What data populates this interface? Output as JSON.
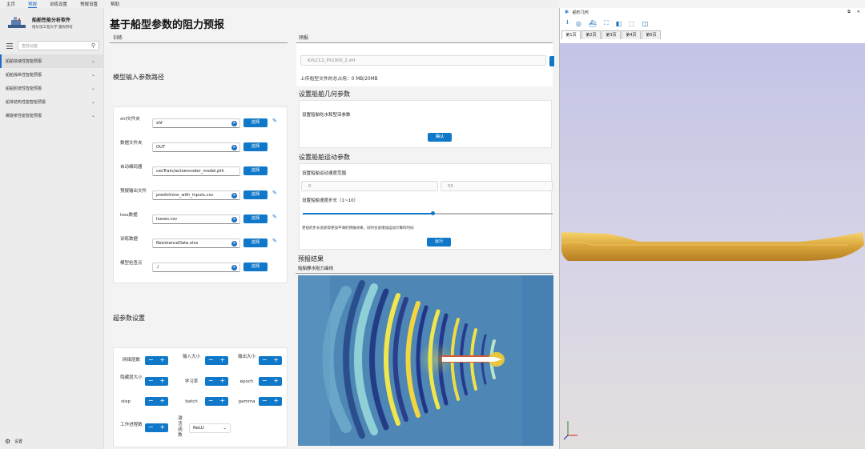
{
  "menu": [
    "主页",
    "预报",
    "训练设置",
    "预报设置",
    "帮助"
  ],
  "app": {
    "name": "船舶性能分析软件",
    "org": "哈尔滨工程大学 版权所有"
  },
  "search": {
    "placeholder": "查找功能"
  },
  "nav": [
    {
      "label": "船舶快速性智能预报"
    },
    {
      "label": "船舶操纵性智能预报"
    },
    {
      "label": "船舶耐波性智能预报"
    },
    {
      "label": "船体结构性能智能预报"
    },
    {
      "label": "螺旋桨性能智能预报"
    }
  ],
  "settings_label": "设置",
  "page_title": "基于船型参数的阻力预报",
  "train": {
    "tab": "训练",
    "path_heading": "模型输入参数路径",
    "fields": [
      {
        "label": "shf文件夹",
        "value": "shf",
        "btn": "选择"
      },
      {
        "label": "数据文件夹",
        "value": "OUT",
        "btn": "选择"
      },
      {
        "label": "自动编码器",
        "value": "cesTrain/autoencoder_model.pth",
        "btn": "选择"
      },
      {
        "label": "预报输出文件",
        "value": "predictions_with_inputs.csv",
        "btn": "选择"
      },
      {
        "label": "loss数据",
        "value": "losses.csv",
        "btn": "选择"
      },
      {
        "label": "训练数据",
        "value": "ResistanceData.xlsx",
        "btn": "选择"
      },
      {
        "label": "模型检查点",
        "value": "./",
        "btn": "选择"
      }
    ],
    "hp_heading": "超参数设置",
    "hyper": [
      "网络层数",
      "输入大小",
      "输出大小",
      "隐藏层大小",
      "学习率",
      "epoch",
      "step",
      "batch",
      "gamma",
      "工作进程数",
      "激活函数"
    ],
    "activation": "ReLU"
  },
  "predict": {
    "tab": "预报",
    "file_value": "KVLCC2_PX1000_2.shf",
    "upload_info": "上传船型文件的总占用：0 MB/20MB",
    "geo_heading": "设置船舶几何参数",
    "geo_sub": "设置船舶吃水和型深参数",
    "confirm": "确认",
    "motion_heading": "设置船舶运动参数",
    "speed_range_label": "设置船舶运动速度范围",
    "speed_min": "0",
    "speed_max": "50",
    "step_label": "设置船舶速度步长（1~10）",
    "slider_fraction": 0.52,
    "hint": "更短的步长会获得更加平滑的预报效果，同时也会增加运动计算的时间",
    "run": "运行",
    "result_heading": "预报结果",
    "curve_label": "船舶静水阻力曲线"
  },
  "cad": {
    "title": "船形几何",
    "tabs": [
      "第1页",
      "第2页",
      "第3页",
      "第4页",
      "第5页"
    ]
  }
}
